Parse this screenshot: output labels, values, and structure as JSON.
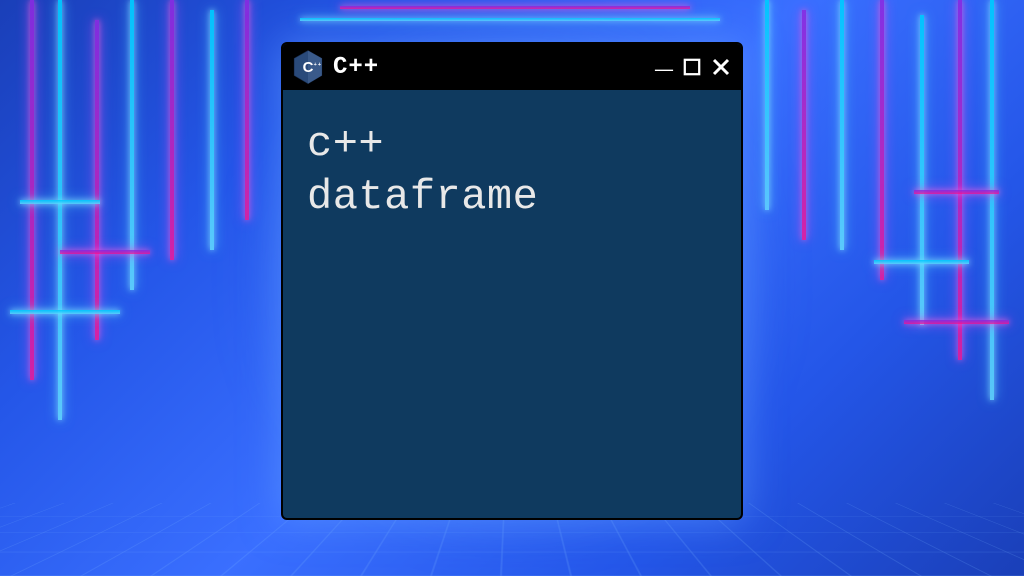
{
  "window": {
    "title": "C++",
    "icon_label": "C++",
    "content_line1": "c++",
    "content_line2": "dataframe"
  },
  "colors": {
    "window_bg": "#0f3a5f",
    "titlebar_bg": "#000000",
    "text": "#e8e8e8"
  }
}
